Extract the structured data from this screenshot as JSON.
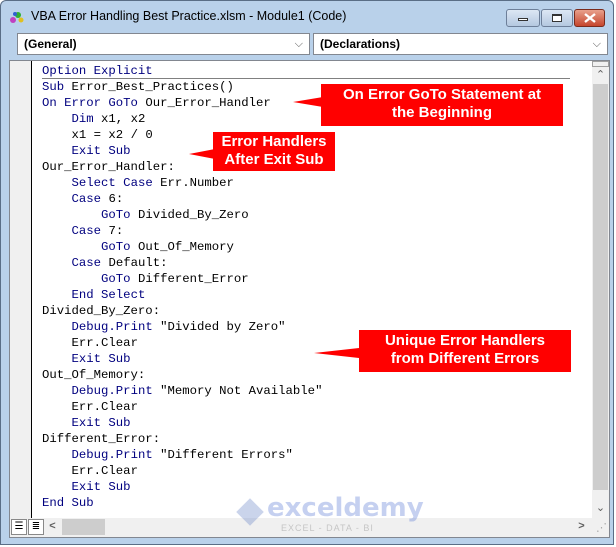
{
  "window": {
    "title": "VBA Error Handling Best Practice.xlsm - Module1 (Code)",
    "buttons": {
      "minimize": "minimize",
      "maximize": "maximize",
      "close": "close"
    }
  },
  "dropdowns": {
    "object": "(General)",
    "procedure": "(Declarations)",
    "chevron": "⌵"
  },
  "code_lines": [
    {
      "indent": 0,
      "tokens": [
        {
          "t": "Option Explicit",
          "k": true
        }
      ]
    },
    {
      "indent": 0,
      "tokens": [
        {
          "t": "Sub",
          "k": true
        },
        {
          "t": " Error_Best_Practices()",
          "k": false
        }
      ]
    },
    {
      "indent": 0,
      "tokens": [
        {
          "t": "On Error GoTo",
          "k": true
        },
        {
          "t": " Our_Error_Handler",
          "k": false
        }
      ]
    },
    {
      "indent": 1,
      "tokens": [
        {
          "t": "Dim",
          "k": true
        },
        {
          "t": " x1, x2",
          "k": false
        }
      ]
    },
    {
      "indent": 1,
      "tokens": [
        {
          "t": "x1 = x2 / 0",
          "k": false
        }
      ]
    },
    {
      "indent": 1,
      "tokens": [
        {
          "t": "Exit Sub",
          "k": true
        }
      ]
    },
    {
      "indent": 0,
      "tokens": [
        {
          "t": "Our_Error_Handler:",
          "k": false
        }
      ]
    },
    {
      "indent": 1,
      "tokens": [
        {
          "t": "Select Case",
          "k": true
        },
        {
          "t": " Err.Number",
          "k": false
        }
      ]
    },
    {
      "indent": 1,
      "tokens": [
        {
          "t": "Case",
          "k": true
        },
        {
          "t": " 6:",
          "k": false
        }
      ]
    },
    {
      "indent": 2,
      "tokens": [
        {
          "t": "GoTo",
          "k": true
        },
        {
          "t": " Divided_By_Zero",
          "k": false
        }
      ]
    },
    {
      "indent": 1,
      "tokens": [
        {
          "t": "Case",
          "k": true
        },
        {
          "t": " 7:",
          "k": false
        }
      ]
    },
    {
      "indent": 2,
      "tokens": [
        {
          "t": "GoTo",
          "k": true
        },
        {
          "t": " Out_Of_Memory",
          "k": false
        }
      ]
    },
    {
      "indent": 1,
      "tokens": [
        {
          "t": "Case",
          "k": true
        },
        {
          "t": " Default:",
          "k": false
        }
      ]
    },
    {
      "indent": 2,
      "tokens": [
        {
          "t": "GoTo",
          "k": true
        },
        {
          "t": " Different_Error",
          "k": false
        }
      ]
    },
    {
      "indent": 1,
      "tokens": [
        {
          "t": "End Select",
          "k": true
        }
      ]
    },
    {
      "indent": 0,
      "tokens": [
        {
          "t": "Divided_By_Zero:",
          "k": false
        }
      ]
    },
    {
      "indent": 1,
      "tokens": [
        {
          "t": "Debug.Print",
          "k": true
        },
        {
          "t": " \"Divided by Zero\"",
          "k": false
        }
      ]
    },
    {
      "indent": 1,
      "tokens": [
        {
          "t": "Err.Clear",
          "k": false
        }
      ]
    },
    {
      "indent": 1,
      "tokens": [
        {
          "t": "Exit Sub",
          "k": true
        }
      ]
    },
    {
      "indent": 0,
      "tokens": [
        {
          "t": "Out_Of_Memory:",
          "k": false
        }
      ]
    },
    {
      "indent": 1,
      "tokens": [
        {
          "t": "Debug.Print",
          "k": true
        },
        {
          "t": " \"Memory Not Available\"",
          "k": false
        }
      ]
    },
    {
      "indent": 1,
      "tokens": [
        {
          "t": "Err.Clear",
          "k": false
        }
      ]
    },
    {
      "indent": 1,
      "tokens": [
        {
          "t": "Exit Sub",
          "k": true
        }
      ]
    },
    {
      "indent": 0,
      "tokens": [
        {
          "t": "Different_Error:",
          "k": false
        }
      ]
    },
    {
      "indent": 1,
      "tokens": [
        {
          "t": "Debug.Print",
          "k": true
        },
        {
          "t": " \"Different Errors\"",
          "k": false
        }
      ]
    },
    {
      "indent": 1,
      "tokens": [
        {
          "t": "Err.Clear",
          "k": false
        }
      ]
    },
    {
      "indent": 1,
      "tokens": [
        {
          "t": "Exit Sub",
          "k": true
        }
      ]
    },
    {
      "indent": 0,
      "tokens": [
        {
          "t": "End Sub",
          "k": true
        }
      ]
    }
  ],
  "callouts": {
    "on_error": {
      "line1": "On Error GoTo Statement at",
      "line2": "the Beginning"
    },
    "handlers": {
      "line1": "Error Handlers",
      "line2": "After Exit Sub"
    },
    "unique": {
      "line1": "Unique Error Handlers",
      "line2": "from Different Errors"
    }
  },
  "scrollbars": {
    "up": "⌃",
    "down": "⌄",
    "left": "<",
    "right": ">",
    "grip": "⋰"
  },
  "watermark": {
    "brand": "exceldemy",
    "tagline": "EXCEL - DATA - BI"
  },
  "colors": {
    "keyword": "#00007f",
    "callout": "#ff0000"
  }
}
